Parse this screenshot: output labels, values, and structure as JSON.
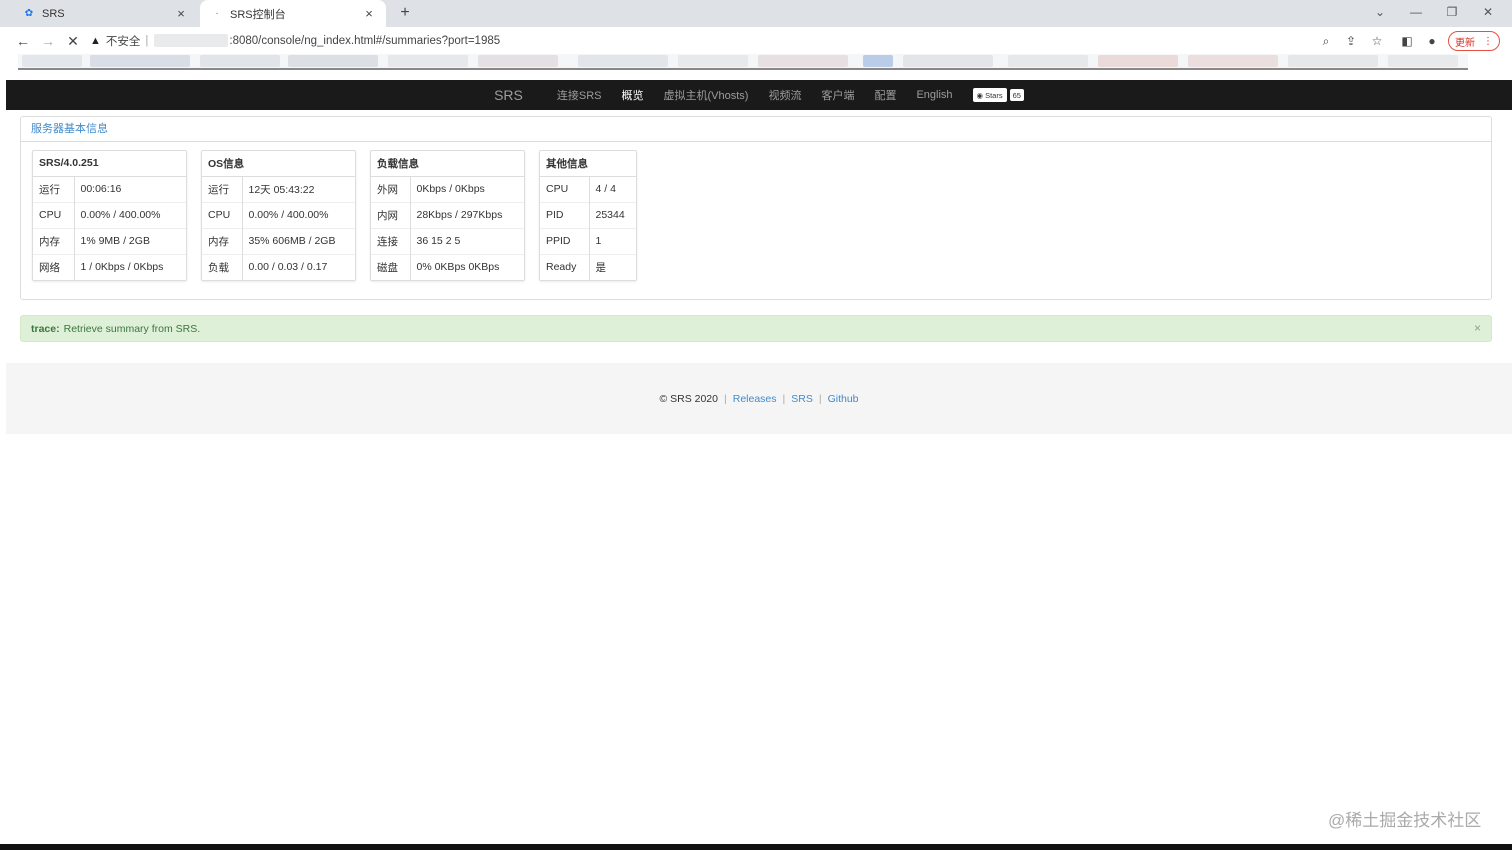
{
  "browser": {
    "tabs": [
      {
        "title": "SRS",
        "active": false
      },
      {
        "title": "SRS控制台",
        "active": true
      }
    ],
    "address": {
      "security_label": "不安全",
      "url_suffix": ":8080/console/ng_index.html#/summaries?port=1985"
    },
    "update_label": "更新"
  },
  "navbar": {
    "brand": "SRS",
    "items": [
      {
        "label": "连接SRS",
        "active": false
      },
      {
        "label": "概览",
        "active": true
      },
      {
        "label": "虚拟主机(Vhosts)",
        "active": false
      },
      {
        "label": "视频流",
        "active": false
      },
      {
        "label": "客户端",
        "active": false
      },
      {
        "label": "配置",
        "active": false
      },
      {
        "label": "English",
        "active": false
      }
    ],
    "github_badge": {
      "label": "Stars",
      "count": "65"
    }
  },
  "panel": {
    "title": "服务器基本信息",
    "cards": [
      {
        "header": "SRS/4.0.251",
        "rows": [
          {
            "k": "运行",
            "v": "00:06:16"
          },
          {
            "k": "CPU",
            "v": "0.00% / 400.00%"
          },
          {
            "k": "内存",
            "v": "1% 9MB / 2GB"
          },
          {
            "k": "网络",
            "v": "1 / 0Kbps / 0Kbps"
          }
        ]
      },
      {
        "header": "OS信息",
        "rows": [
          {
            "k": "运行",
            "v": "12天 05:43:22"
          },
          {
            "k": "CPU",
            "v": "0.00% / 400.00%"
          },
          {
            "k": "内存",
            "v": "35% 606MB / 2GB"
          },
          {
            "k": "负载",
            "v": "0.00 / 0.03 / 0.17"
          }
        ]
      },
      {
        "header": "负载信息",
        "rows": [
          {
            "k": "外网",
            "v": "0Kbps / 0Kbps"
          },
          {
            "k": "内网",
            "v": "28Kbps / 297Kbps"
          },
          {
            "k": "连接",
            "v": "36 15 2 5"
          },
          {
            "k": "磁盘",
            "v": "0% 0KBps 0KBps"
          }
        ]
      },
      {
        "header": "其他信息",
        "rows": [
          {
            "k": "CPU",
            "v": "4 / 4"
          },
          {
            "k": "PID",
            "v": "25344"
          },
          {
            "k": "PPID",
            "v": "1"
          },
          {
            "k": "Ready",
            "v": "是"
          }
        ]
      }
    ]
  },
  "alert": {
    "label": "trace:",
    "message": "Retrieve summary from SRS."
  },
  "footer": {
    "copyright": "© SRS 2020",
    "links": [
      "Releases",
      "SRS",
      "Github"
    ]
  },
  "watermark": "@稀土掘金技术社区"
}
